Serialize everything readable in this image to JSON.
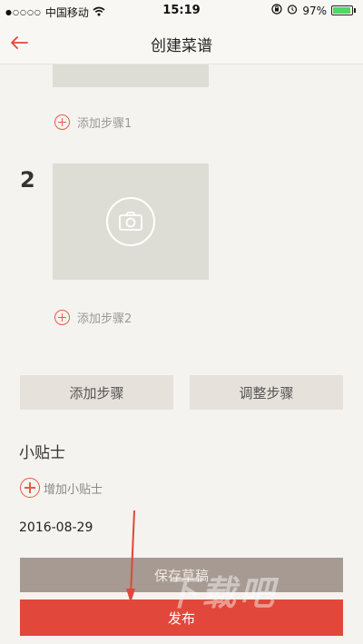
{
  "status_bar": {
    "carrier": "中国移动",
    "time": "15:19",
    "battery_percent": "97%",
    "battery_level": 0.97,
    "signal_icon": "signal-dots-icon",
    "wifi_icon": "wifi-icon",
    "lock_icon": "orientation-lock-icon",
    "alarm_icon": "alarm-icon"
  },
  "nav": {
    "title": "创建菜谱",
    "back_icon": "back-arrow-icon"
  },
  "steps": {
    "add_step_1": "添加步骤1",
    "step_2_number": "2",
    "add_step_2": "添加步骤2"
  },
  "actions": {
    "add_step": "添加步骤",
    "adjust_steps": "调整步骤"
  },
  "tips": {
    "title": "小贴士",
    "add_tip": "增加小贴士"
  },
  "date": "2016-08-29",
  "footer": {
    "save_draft": "保存草稿",
    "publish": "发布"
  },
  "watermark": "下载吧",
  "colors": {
    "accent": "#e1473a",
    "background": "#f5f3ef",
    "save_button": "#a69a92"
  }
}
